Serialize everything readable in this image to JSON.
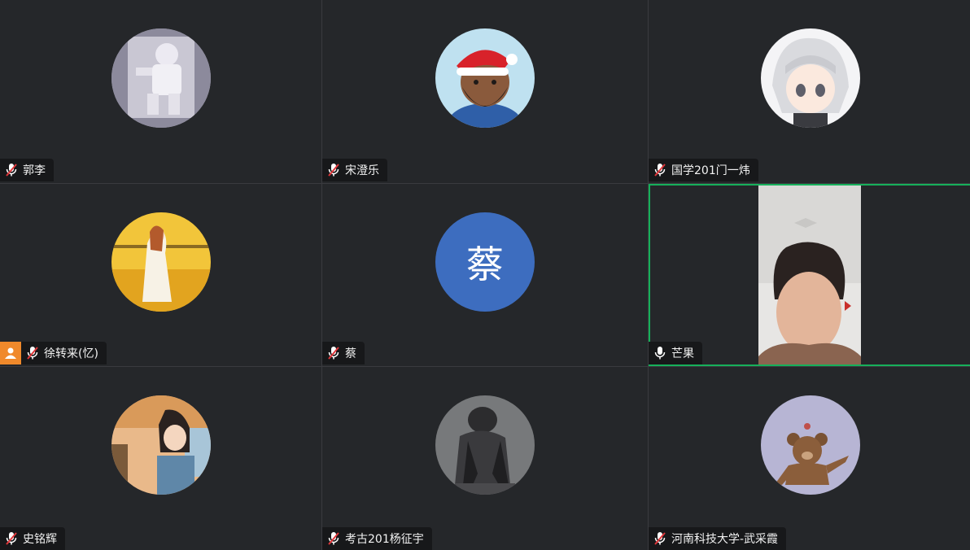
{
  "participants": [
    {
      "name": "郭李",
      "mic": "muted",
      "avatar": "astronaut-avatar"
    },
    {
      "name": "宋澄乐",
      "mic": "muted",
      "avatar": "santa-cartoon-avatar"
    },
    {
      "name": "国学201门一炜",
      "mic": "muted",
      "avatar": "anime-girl-avatar"
    },
    {
      "name": "徐转来(忆)",
      "mic": "muted",
      "avatar": "girl-in-field-avatar",
      "host": true
    },
    {
      "name": "蔡",
      "mic": "muted",
      "avatar_letter": "蔡",
      "avatar_color": "#3d6dbf"
    },
    {
      "name": "芒果",
      "mic": "on",
      "video": true,
      "active_speaker": true
    },
    {
      "name": "史铭辉",
      "mic": "muted",
      "avatar": "cartoon-girl-avatar"
    },
    {
      "name": "考古201杨征宇",
      "mic": "muted",
      "avatar": "sculpture-avatar"
    },
    {
      "name": "河南科技大学-武采霞",
      "mic": "muted",
      "avatar": "teddy-bear-avatar"
    }
  ],
  "colors": {
    "background": "#25272a",
    "nameplate": "#17181a",
    "active_border": "#16b05a",
    "host_badge": "#f0892b",
    "muted_slash": "#e0363a"
  }
}
